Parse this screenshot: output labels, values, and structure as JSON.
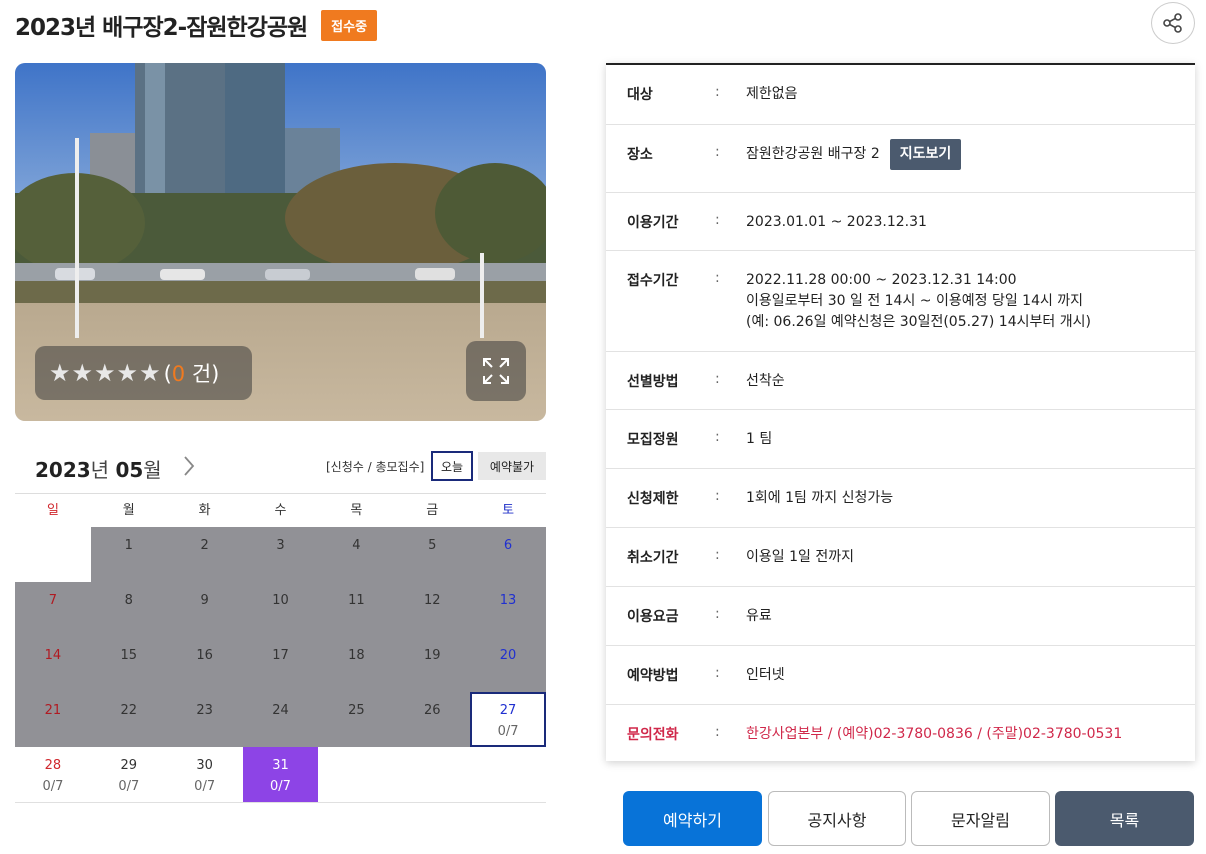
{
  "header": {
    "title": "2023년 배구장2-잠원한강공원",
    "status_badge": "접수중",
    "share_icon": "share-icon"
  },
  "photo": {
    "rating": {
      "stars_total": 5,
      "stars_filled": 0,
      "count_prefix": "(",
      "count": "0",
      "count_suffix": " 건)"
    },
    "expand_icon": "expand-icon"
  },
  "calendar": {
    "year": "2023",
    "year_unit": "년",
    "month": "05",
    "month_unit": "월",
    "legend": "[신청수 / 총모집수]",
    "today_label": "오늘",
    "unavailable_label": "예약불가",
    "weekdays": [
      "일",
      "월",
      "화",
      "수",
      "목",
      "금",
      "토"
    ],
    "weeks": [
      [
        {
          "d": "",
          "state": "blank"
        },
        {
          "d": "1",
          "state": "past"
        },
        {
          "d": "2",
          "state": "past"
        },
        {
          "d": "3",
          "state": "past"
        },
        {
          "d": "4",
          "state": "past"
        },
        {
          "d": "5",
          "state": "past"
        },
        {
          "d": "6",
          "state": "past"
        }
      ],
      [
        {
          "d": "7",
          "state": "past"
        },
        {
          "d": "8",
          "state": "past"
        },
        {
          "d": "9",
          "state": "past"
        },
        {
          "d": "10",
          "state": "past"
        },
        {
          "d": "11",
          "state": "past"
        },
        {
          "d": "12",
          "state": "past"
        },
        {
          "d": "13",
          "state": "past"
        }
      ],
      [
        {
          "d": "14",
          "state": "past"
        },
        {
          "d": "15",
          "state": "past"
        },
        {
          "d": "16",
          "state": "past"
        },
        {
          "d": "17",
          "state": "past"
        },
        {
          "d": "18",
          "state": "past"
        },
        {
          "d": "19",
          "state": "past"
        },
        {
          "d": "20",
          "state": "past"
        }
      ],
      [
        {
          "d": "21",
          "state": "past"
        },
        {
          "d": "22",
          "state": "past"
        },
        {
          "d": "23",
          "state": "past"
        },
        {
          "d": "24",
          "state": "past"
        },
        {
          "d": "25",
          "state": "past"
        },
        {
          "d": "26",
          "state": "past"
        },
        {
          "d": "27",
          "state": "today",
          "cnt": "0/7"
        }
      ],
      [
        {
          "d": "28",
          "state": "open",
          "cnt": "0/7"
        },
        {
          "d": "29",
          "state": "open",
          "cnt": "0/7"
        },
        {
          "d": "30",
          "state": "open",
          "cnt": "0/7"
        },
        {
          "d": "31",
          "state": "selected",
          "cnt": "0/7"
        },
        {
          "d": "",
          "state": "blank"
        },
        {
          "d": "",
          "state": "blank"
        },
        {
          "d": "",
          "state": "blank"
        }
      ]
    ]
  },
  "info": {
    "rows": [
      {
        "key": "대상",
        "val": [
          "제한없음"
        ],
        "h": 60
      },
      {
        "key": "장소",
        "val": [
          "잠원한강공원 배구장 2"
        ],
        "map": "지도보기",
        "h": 68
      },
      {
        "key": "이용기간",
        "val": [
          "2023.01.01 ~ 2023.12.31"
        ],
        "h": 58
      },
      {
        "key": "접수기간",
        "val": [
          "2022.11.28 00:00 ~ 2023.12.31 14:00",
          "이용일로부터 30 일 전 14시 ~ 이용예정 당일 14시 까지",
          "(예: 06.26일 예약신청은 30일전(05.27) 14시부터 개시)"
        ],
        "h": 101
      },
      {
        "key": "선별방법",
        "val": [
          "선착순"
        ],
        "h": 58
      },
      {
        "key": "모집정원",
        "val": [
          "1 팀"
        ],
        "h": 59
      },
      {
        "key": "신청제한",
        "val": [
          "1회에 1팀 까지 신청가능"
        ],
        "h": 59
      },
      {
        "key": "취소기간",
        "val": [
          "이용일 1일 전까지"
        ],
        "h": 59
      },
      {
        "key": "이용요금",
        "val": [
          "유료"
        ],
        "h": 59
      },
      {
        "key": "예약방법",
        "val": [
          "인터넷"
        ],
        "h": 59
      },
      {
        "key": "문의전화",
        "val": [
          "한강사업본부 / (예약)02-3780-0836 / (주말)02-3780-0531"
        ],
        "h": 58,
        "contact": true
      }
    ],
    "colon": ":"
  },
  "buttons": {
    "reserve": "예약하기",
    "notice": "공지사항",
    "sms": "문자알림",
    "list": "목록"
  },
  "colors": {
    "badge": "#f07a1f",
    "primary": "#0873d8",
    "dark": "#4b5a6e",
    "selected": "#8d44e6",
    "past": "#919196",
    "contact": "#d0284a"
  }
}
